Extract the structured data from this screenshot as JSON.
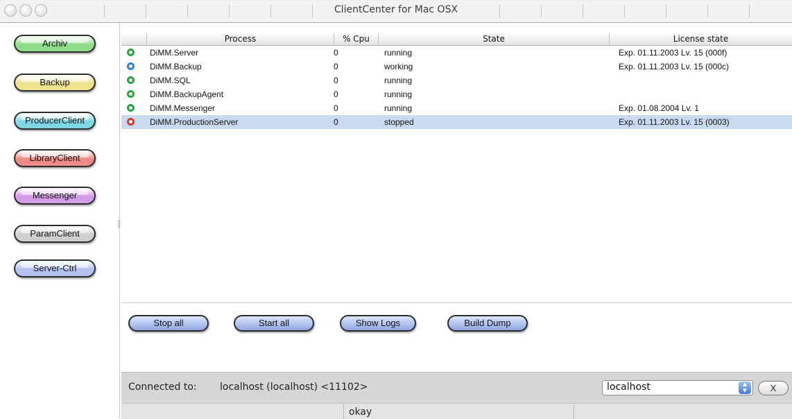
{
  "window": {
    "title": "ClientCenter for Mac OSX"
  },
  "sidebar": {
    "items": [
      {
        "label": "Archiv",
        "color": "#8fdc8a"
      },
      {
        "label": "Backup",
        "color": "#efe28c"
      },
      {
        "label": "ProducerClient",
        "color": "#7fd7e6"
      },
      {
        "label": "LibraryClient",
        "color": "#ef8a86"
      },
      {
        "label": "Messenger",
        "color": "#d39be8"
      },
      {
        "label": "ParamClient",
        "color": "#cfcfcf"
      },
      {
        "label": "Server-Ctrl",
        "color": "#b4c2f1"
      }
    ]
  },
  "table": {
    "columns": {
      "process": "Process",
      "cpu": "% Cpu",
      "state": "State",
      "license": "License state"
    },
    "rows": [
      {
        "process": "DiMM.Server",
        "cpu": "0",
        "state": "running",
        "license": "Exp. 01.11.2003 Lv. 15 (000f)",
        "icon_color": "#22a83a",
        "selected": false
      },
      {
        "process": "DiMM.Backup",
        "cpu": "0",
        "state": "working",
        "license": "Exp. 01.11.2003 Lv. 15 (000c)",
        "icon_color": "#2a7fd8",
        "selected": false
      },
      {
        "process": "DiMM.SQL",
        "cpu": "0",
        "state": "running",
        "license": "",
        "icon_color": "#22a83a",
        "selected": false
      },
      {
        "process": "DiMM.BackupAgent",
        "cpu": "0",
        "state": "running",
        "license": "",
        "icon_color": "#22a83a",
        "selected": false
      },
      {
        "process": "DiMM.Messenger",
        "cpu": "0",
        "state": "running",
        "license": "Exp. 01.08.2004 Lv. 1",
        "icon_color": "#22a83a",
        "selected": false
      },
      {
        "process": "DiMM.ProductionServer",
        "cpu": "0",
        "state": "stopped",
        "license": "Exp. 01.11.2003 Lv. 15 (0003)",
        "icon_color": "#d23a2a",
        "selected": true
      }
    ]
  },
  "actions": {
    "stop_all": "Stop all",
    "start_all": "Start all",
    "show_logs": "Show Logs",
    "build_dump": "Build Dump"
  },
  "connection": {
    "label": "Connected to:",
    "value": "localhost (localhost) <11102>",
    "host_selected": "localhost",
    "close_label": "X"
  },
  "status": {
    "text": "okay"
  },
  "colors": {
    "selection": "#c9d9ef",
    "action_button": "#b3c3f0"
  }
}
